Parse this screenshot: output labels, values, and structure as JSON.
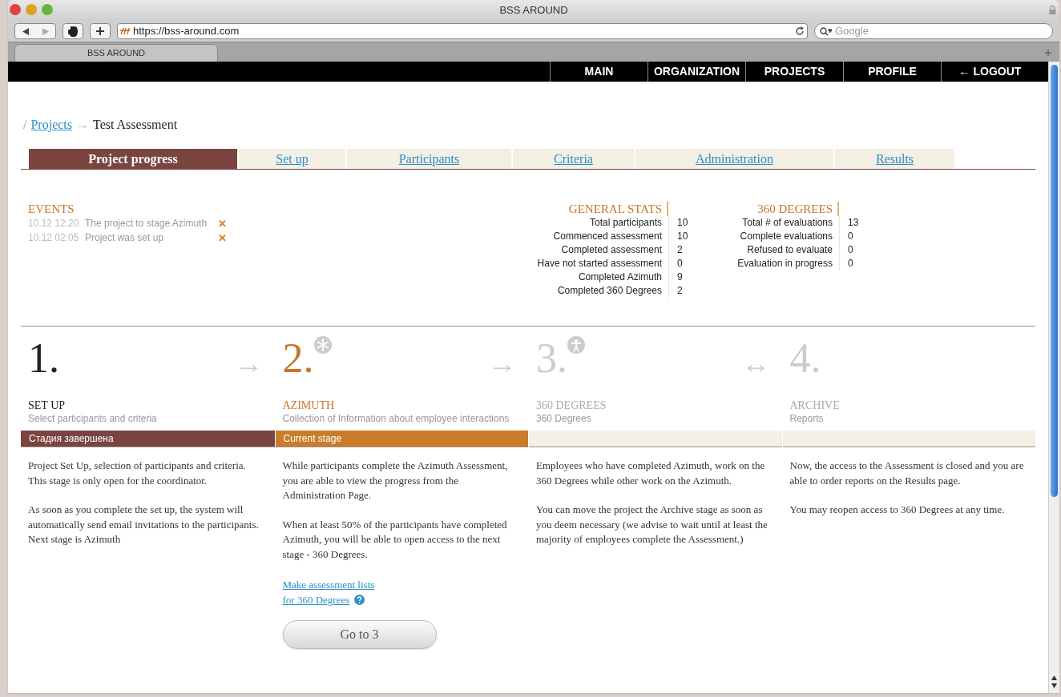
{
  "window": {
    "title": "BSS AROUND"
  },
  "browser": {
    "url": "https://bss-around.com",
    "search_placeholder": "Google",
    "tabs": [
      {
        "label": "BSS AROUND",
        "selected": true
      }
    ]
  },
  "nav": [
    {
      "label": "MAIN"
    },
    {
      "label": "ORGANIZATION"
    },
    {
      "label": "PROJECTS"
    },
    {
      "label": "PROFILE"
    },
    {
      "label": "← LOGOUT"
    }
  ],
  "breadcrumb": {
    "separator": "/",
    "link": "Projects",
    "arrow": "→",
    "current": "Test Assessment"
  },
  "tabs": [
    {
      "label": "Project progress",
      "selected": true
    },
    {
      "label": "Set up",
      "selected": false
    },
    {
      "label": "Participants",
      "selected": false
    },
    {
      "label": "Criteria",
      "selected": false
    },
    {
      "label": "Administration",
      "selected": false
    },
    {
      "label": "Results",
      "selected": false
    }
  ],
  "events": {
    "title": "EVENTS",
    "items": [
      {
        "time": "10.12 12:20",
        "text": "The project to stage Azimuth",
        "remove": "✕"
      },
      {
        "time": "10.12 02:05",
        "text": "Project was set up",
        "remove": "✕"
      }
    ]
  },
  "stats": [
    {
      "title": "GENERAL STATS",
      "rows": [
        {
          "label": "Total participants",
          "value": "10"
        },
        {
          "label": "Commenced assessment",
          "value": "10"
        },
        {
          "label": "Completed assessment",
          "value": "2"
        },
        {
          "label": "Have not started assessment",
          "value": "0"
        },
        {
          "label": "Completed Azimuth",
          "value": "9"
        },
        {
          "label": "Completed 360 Degrees",
          "value": "2"
        }
      ]
    },
    {
      "title": "360 DEGREES",
      "rows": [
        {
          "label": "Total # of evaluations",
          "value": "13"
        },
        {
          "label": "Complete evaluations",
          "value": "0"
        },
        {
          "label": "Refused to evaluate",
          "value": "0"
        },
        {
          "label": "Evaluation in progress",
          "value": "0"
        }
      ]
    }
  ],
  "stages": [
    {
      "number": "1.",
      "kind": "done",
      "title": "SET UP",
      "subtitle": "Select participants and criteria",
      "band": "Стадия завершена",
      "connector": "→",
      "paragraphs": [
        "Project Set Up, selection of participants and criteria. This stage is only open for the coordinator.",
        "As soon as you complete the set up, the system will automatically send email invitations to the participants. Next stage is Azimuth"
      ]
    },
    {
      "number": "2.",
      "kind": "current",
      "title": "AZIMUTH",
      "subtitle": "Collection of Information about employee interactions",
      "band": "Current stage",
      "connector": "→",
      "paragraphs": [
        "While participants complete the Azimuth Assessment, you are able to view the progress from the Administration Page.",
        "When at least 50% of the participants have completed Azimuth, you will be able to open access to the next stage - 360 Degrees."
      ],
      "links": [
        "Make assessment lists",
        "for 360 Degrees"
      ],
      "button": "Go to 3"
    },
    {
      "number": "3.",
      "kind": "future",
      "title": "360 DEGREES",
      "subtitle": "360 Degrees",
      "connector": "↔",
      "paragraphs": [
        "Employees who have completed Azimuth, work on the 360 Degrees while other work on the Azimuth.",
        "You can move the project the Archive stage as soon as you deem necessary (we advise to wait until at least the majority of employees complete the Assessment.)"
      ]
    },
    {
      "number": "4.",
      "kind": "future",
      "title": "ARCHIVE",
      "subtitle": "Reports",
      "paragraphs": [
        "Now, the access to the Assessment is closed and you are able to order reports on the Results page.",
        "You may reopen access to 360 Degrees at any time."
      ]
    }
  ]
}
